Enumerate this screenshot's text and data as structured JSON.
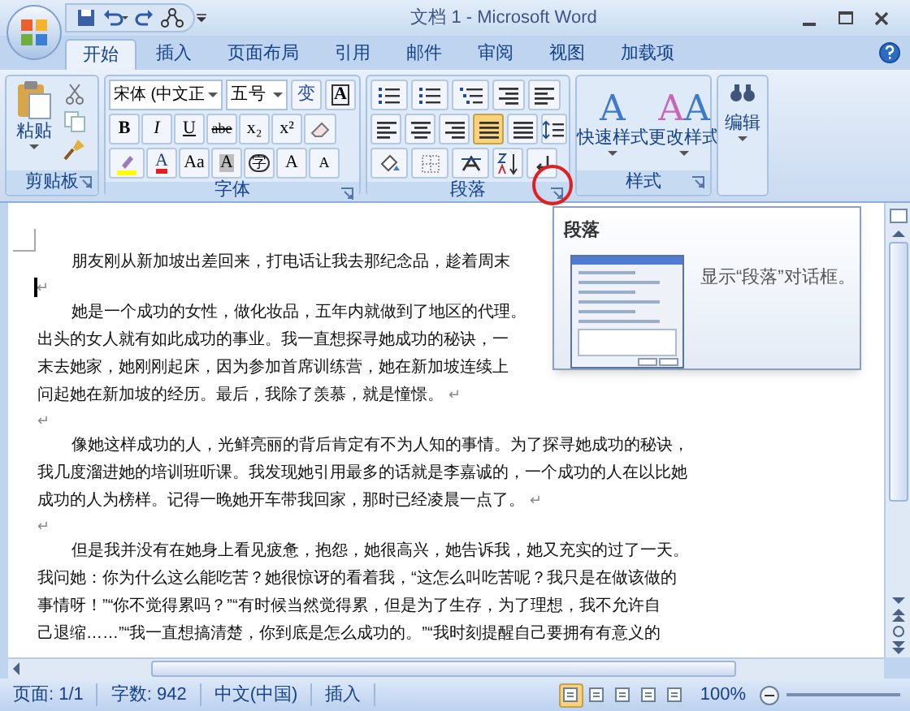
{
  "window": {
    "title": "文档 1 - Microsoft Word"
  },
  "tabs": [
    {
      "label": "开始",
      "selected": true
    },
    {
      "label": "插入",
      "selected": false
    },
    {
      "label": "页面布局",
      "selected": false
    },
    {
      "label": "引用",
      "selected": false
    },
    {
      "label": "邮件",
      "selected": false
    },
    {
      "label": "审阅",
      "selected": false
    },
    {
      "label": "视图",
      "selected": false
    },
    {
      "label": "加载项",
      "selected": false
    }
  ],
  "ribbon": {
    "clipboard": {
      "paste_label": "粘贴",
      "group_label": "剪贴板"
    },
    "font": {
      "font_name": "宋体 (中文正",
      "font_size": "五号",
      "phonetic": "变",
      "border_char": "A",
      "format_buttons": [
        "B",
        "I",
        "U",
        "abe",
        "x₂",
        "x²"
      ],
      "color_buttons": [
        "A",
        "Aa",
        "A",
        "字",
        "A",
        "A"
      ],
      "group_label": "字体"
    },
    "paragraph": {
      "group_label": "段落",
      "alignments": [
        {
          "kind": "left",
          "selected": false
        },
        {
          "kind": "center",
          "selected": false
        },
        {
          "kind": "right",
          "selected": false
        },
        {
          "kind": "justify",
          "selected": true
        },
        {
          "kind": "distributed",
          "selected": false
        }
      ]
    },
    "styles": {
      "buttons": [
        {
          "glyphs": [
            "A"
          ],
          "label": "快速样式"
        },
        {
          "glyphs": [
            "A",
            "A"
          ],
          "label": "更改样式"
        }
      ],
      "group_label": "样式"
    },
    "editing": {
      "label": "编辑"
    }
  },
  "tooltip": {
    "title": "段落",
    "description": "显示“段落”对话框。"
  },
  "document": {
    "paragraphs": [
      {
        "lines": [
          "朋友刚从新加坡出差回来，打电话让我去那纪念品，趁着周末"
        ]
      },
      {
        "end_mark": "↵",
        "cursor": true
      },
      {
        "lines": [
          "她是一个成功的女性，做化妆品，五年内就做到了地区的代理。",
          "出头的女人就有如此成功的事业。我一直想探寻她成功的秘诀，一",
          "末去她家，她刚刚起床，因为参加首席训练营，她在新加坡连续上",
          "问起她在新加坡的经历。最后，我除了羡慕，就是憧憬。"
        ],
        "end_mark": "↵"
      },
      {
        "end_mark": "↵"
      },
      {
        "lines": [
          "像她这样成功的人，光鲜亮丽的背后肯定有不为人知的事情。为了探寻她成功的秘诀，",
          "我几度溜进她的培训班听课。我发现她引用最多的话就是李嘉诚的，一个成功的人在以比她",
          "成功的人为榜样。记得一晚她开车带我回家，那时已经凌晨一点了。"
        ],
        "end_mark": "↵"
      },
      {
        "end_mark": "↵"
      },
      {
        "lines": [
          "但是我并没有在她身上看见疲惫，抱怨，她很高兴，她告诉我，她又充实的过了一天。",
          "我问她：你为什么这么能吃苦？她很惊讶的看着我，“这怎么叫吃苦呢？我只是在做该做的",
          "事情呀！”“你不觉得累吗？”“有时候当然觉得累，但是为了生存，为了理想，我不允许自",
          "己退缩……”“我一直想搞清楚，你到底是怎么成功的。”“我时刻提醒自己要拥有有意义的"
        ]
      }
    ]
  },
  "status_bar": {
    "items": [
      "页面: 1/1",
      "字数: 942",
      "中文(中国)",
      "插入"
    ],
    "views": [
      {
        "selected": true
      },
      {
        "selected": false
      },
      {
        "selected": false
      },
      {
        "selected": false
      },
      {
        "selected": false
      }
    ],
    "zoom": "100%"
  }
}
